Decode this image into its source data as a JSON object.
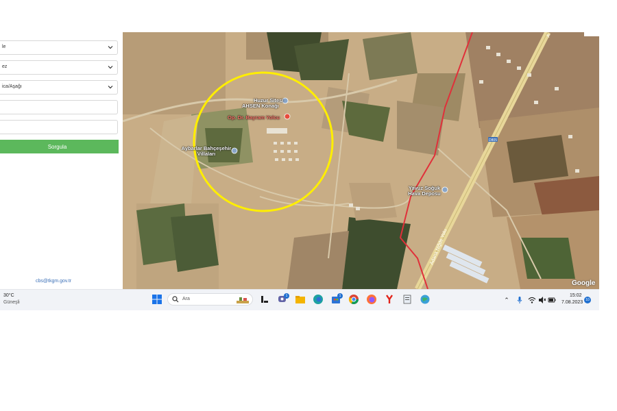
{
  "form": {
    "select_1": "le",
    "select_2": "ez",
    "select_3": "ica/Aşağı",
    "input_1": "",
    "input_2": "",
    "submit_label": "Sorgula",
    "footer_email": "cbs@tkgm.gov.tr"
  },
  "map": {
    "places": [
      {
        "name": "Huzur Sitesi",
        "type": "pin"
      },
      {
        "name": "AHSEN Konağı",
        "type": "pin"
      },
      {
        "name": "Op. Dr. Bayram Yolcu",
        "type": "red-pin"
      },
      {
        "name": "Aybarlar Bahçeşehir Villaları",
        "type": "pin"
      },
      {
        "name": "Yavuz Soğuk Hava Deposu",
        "type": "pin"
      }
    ],
    "road_label_vertical": "Adana Niğde Yolu",
    "road_shield": "D805",
    "top_road_label": "A",
    "attribution": "Google",
    "highlight_circle_color": "#ffee00",
    "boundary_line_color": "#e0303a"
  },
  "taskbar": {
    "weather_temp": "30°C",
    "weather_desc": "Güneşli",
    "search_placeholder": "Ara",
    "badge_teams": "1",
    "badge_store": "1",
    "clock_time": "15:02",
    "clock_date": "7.08.2023",
    "notification_count": "10"
  }
}
